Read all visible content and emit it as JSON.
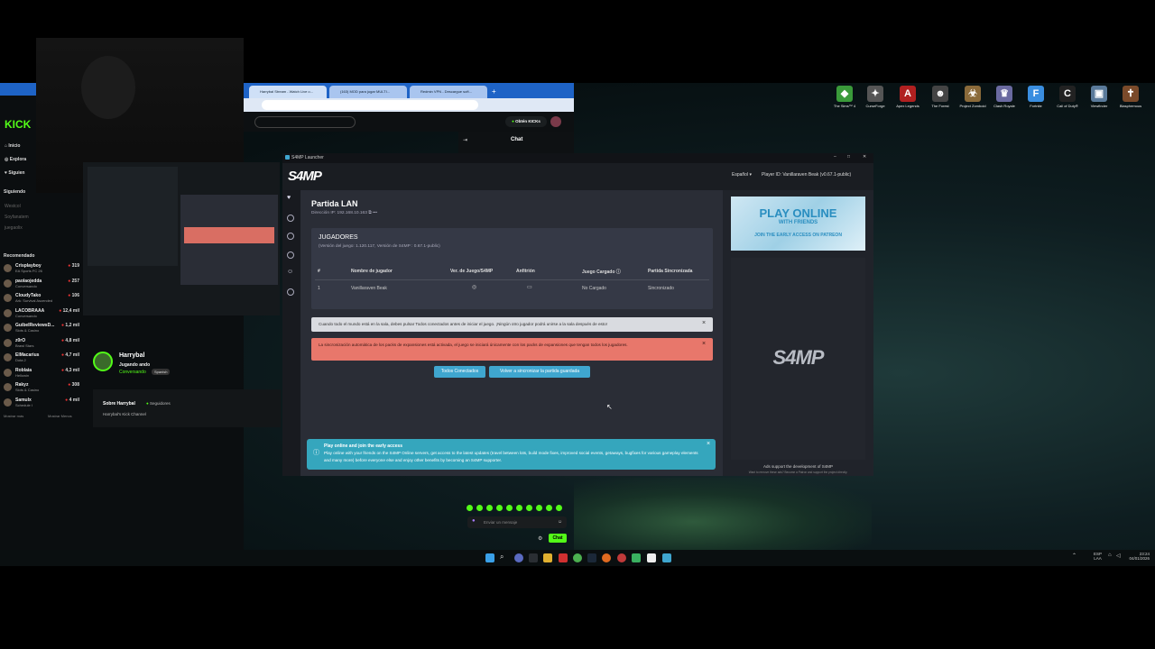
{
  "desktop": {
    "icons": [
      {
        "label": "The Sims™ 4",
        "icon": "sims-icon",
        "color": "#3a9a3a",
        "glyph": "◆"
      },
      {
        "label": "CurseForge",
        "icon": "curseforge-icon",
        "color": "#555555",
        "glyph": "✦"
      },
      {
        "label": "Apex Legends",
        "icon": "apex-icon",
        "color": "#b02020",
        "glyph": "A"
      },
      {
        "label": "The Forest",
        "icon": "forest-icon",
        "color": "#444444",
        "glyph": "☻"
      },
      {
        "label": "Project Zomboid",
        "icon": "zomboid-icon",
        "color": "#8a6a3a",
        "glyph": "☣"
      },
      {
        "label": "Clash Royale",
        "icon": "clash-icon",
        "color": "#6a6aa0",
        "glyph": "♛"
      },
      {
        "label": "Fortnite",
        "icon": "fortnite-icon",
        "color": "#3a8ee0",
        "glyph": "F"
      },
      {
        "label": "Call of Duty®",
        "icon": "cod-icon",
        "color": "#222222",
        "glyph": "C"
      },
      {
        "label": "Viewfinder",
        "icon": "viewfinder-icon",
        "color": "#5a7a9a",
        "glyph": "▣"
      },
      {
        "label": "Blasphemous",
        "icon": "blasphemous-icon",
        "color": "#7a4a2a",
        "glyph": "✝"
      }
    ]
  },
  "taskbar": {
    "lang": "ESP",
    "lang2": "LAA",
    "time": "23:24",
    "date": "04/01/2026"
  },
  "browser": {
    "tabs": [
      "Harrybal Stream - Watch Live o...",
      "(163) MOD para jugar MULTI...",
      "Redmin VPN - Descargue soft..."
    ],
    "kick": {
      "logo": "KICK",
      "nav": [
        "Inicio",
        "Explora",
        "Siguien"
      ],
      "following_title": "Siguiendo",
      "following": [
        "Westcol",
        "Soyfanatem",
        "juegaolix"
      ],
      "recommended_title": "Recomendado",
      "recommended": [
        {
          "name": "Crisplayboy",
          "sub": "EA Sports FC 26",
          "count": "319"
        },
        {
          "name": "paolaojedda",
          "sub": "Conversando",
          "count": "257"
        },
        {
          "name": "CloudyTako",
          "sub": "Ark: Survival Ascended",
          "count": "106"
        },
        {
          "name": "LACOBRAAA",
          "sub": "Conversando",
          "count": "12,4 mil"
        },
        {
          "name": "GuibelReviewsD...",
          "sub": "Slots & Casino",
          "count": "1,2 mil"
        },
        {
          "name": "z0rO",
          "sub": "Brawl Stars",
          "count": "4,8 mil"
        },
        {
          "name": "ElMacarius",
          "sub": "Dota 2",
          "count": "4,7 mil"
        },
        {
          "name": "Roblaia",
          "sub": "Hellowin",
          "count": "4,3 mil"
        },
        {
          "name": "Rakyz",
          "sub": "Slots & Casino",
          "count": "308"
        },
        {
          "name": "Samulx",
          "sub": "Schedule I",
          "count": "4 mil"
        }
      ],
      "show_more": "Mostrar más",
      "show_less": "Mostrar Menos",
      "get_kicks": "Obtén KICKs",
      "chat_title": "Chat",
      "streamer": "Harrybal",
      "streamer_status": "Jugando ando",
      "streamer_category": "Conversando",
      "streamer_lang": "Spanish",
      "about_title": "Sobre Harrybal",
      "about_followers": "Seguidores",
      "about_desc": "Harrybal's Kick Channel",
      "chat_placeholder": "Enviar un mensaje",
      "chat_button": "Chat"
    }
  },
  "launcher": {
    "window_title": "S4MP Launcher",
    "logo": "S4MP",
    "language": "Español",
    "player_id": "Player ID: Vanillaraven Beak (v0.67.1-public)",
    "title": "Partida LAN",
    "ip": "Dirección IP: 192.168.10.163",
    "players_card": {
      "title": "JUGADORES",
      "subtitle": "(Versión del juego: 1.120.117, Versión de S4MP : 0.67.1-public)",
      "headers": [
        "#",
        "Nombre de jugador",
        "Ver. de Juego/S4MP",
        "Anfitrión",
        "Juego Cargado",
        "Partida Sincronizada"
      ],
      "rows": [
        {
          "num": "1",
          "name": "Vanillaraven Beak",
          "loaded": "No Cargado",
          "synced": "Sincronizado"
        }
      ]
    },
    "alert_warning": "Cuando todo el mundo está en la sala, debes pulsar Todos conectados antes de iniciar el juego. ¡Ningún otro jugador podrá unirse a la sala después de esto!",
    "alert_error": "La sincronización automática de los packs de expansiones está activada, el juego se iniciará únicamente con los packs de expansiones que tengan todos los jugadores.",
    "btn_all_connected": "Todos Conectados",
    "btn_resync": "Volver a sincronizar la partida guardada",
    "promo_title": "Play online and join the early access",
    "promo_text": "Play online with your friends on the S4MP Online servers, get access to the latest updates (travel between lots, build mode fixes, improved social events, getaways, bugfixes for various gameplay elements and many more) before everyone else and enjoy other benefits by becoming an S4MP supporter.",
    "ad": {
      "line1": "PLAY ONLINE",
      "line2": "WITH FRIENDS",
      "line3": "JOIN THE EARLY ACCESS ON PATREON",
      "logo": "S4MP",
      "support": "Ads support the development of S4MP",
      "remove": "Want to remove these ads? Become a Patron and support the project directly."
    }
  }
}
